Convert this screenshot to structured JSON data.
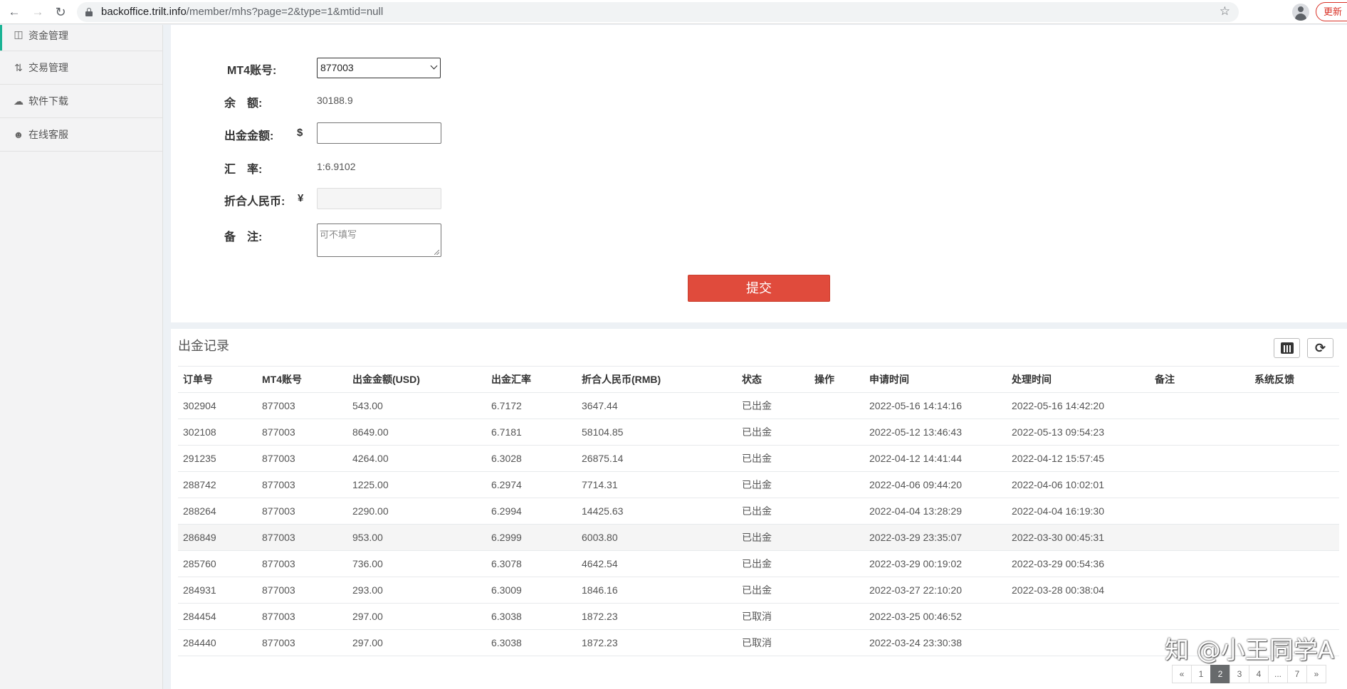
{
  "browser": {
    "url_host": "backoffice.trilt.info",
    "url_path": "/member/mhs?page=2&type=1&mtid=null",
    "update_label": "更新"
  },
  "sidebar": {
    "items": [
      {
        "label": "资金管理",
        "icon": "wallet-icon"
      },
      {
        "label": "交易管理",
        "icon": "trade-icon"
      },
      {
        "label": "软件下载",
        "icon": "cloud-download-icon"
      },
      {
        "label": "在线客服",
        "icon": "user-icon"
      }
    ]
  },
  "form": {
    "account_label": "MT4账号:",
    "account_value": "877003",
    "balance_label": "余　额:",
    "balance_value": "30188.9",
    "amount_label": "出金金额:",
    "amount_symbol": "$",
    "amount_value": "",
    "rate_label": "汇　率:",
    "rate_value": "1:6.9102",
    "rmb_label": "折合人民币:",
    "rmb_symbol": "¥",
    "rmb_value": "",
    "remark_label": "备　注:",
    "remark_placeholder": "可不填写",
    "submit_label": "提交"
  },
  "records": {
    "title": "出金记录",
    "columns": [
      "订单号",
      "MT4账号",
      "出金金额(USD)",
      "出金汇率",
      "折合人民币(RMB)",
      "状态",
      "操作",
      "申请时间",
      "处理时间",
      "备注",
      "系统反馈"
    ],
    "rows": [
      [
        "302904",
        "877003",
        "543.00",
        "6.7172",
        "3647.44",
        "已出金",
        "",
        "2022-05-16 14:14:16",
        "2022-05-16 14:42:20",
        "",
        ""
      ],
      [
        "302108",
        "877003",
        "8649.00",
        "6.7181",
        "58104.85",
        "已出金",
        "",
        "2022-05-12 13:46:43",
        "2022-05-13 09:54:23",
        "",
        ""
      ],
      [
        "291235",
        "877003",
        "4264.00",
        "6.3028",
        "26875.14",
        "已出金",
        "",
        "2022-04-12 14:41:44",
        "2022-04-12 15:57:45",
        "",
        ""
      ],
      [
        "288742",
        "877003",
        "1225.00",
        "6.2974",
        "7714.31",
        "已出金",
        "",
        "2022-04-06 09:44:20",
        "2022-04-06 10:02:01",
        "",
        ""
      ],
      [
        "288264",
        "877003",
        "2290.00",
        "6.2994",
        "14425.63",
        "已出金",
        "",
        "2022-04-04 13:28:29",
        "2022-04-04 16:19:30",
        "",
        ""
      ],
      [
        "286849",
        "877003",
        "953.00",
        "6.2999",
        "6003.80",
        "已出金",
        "",
        "2022-03-29 23:35:07",
        "2022-03-30 00:45:31",
        "",
        ""
      ],
      [
        "285760",
        "877003",
        "736.00",
        "6.3078",
        "4642.54",
        "已出金",
        "",
        "2022-03-29 00:19:02",
        "2022-03-29 00:54:36",
        "",
        ""
      ],
      [
        "284931",
        "877003",
        "293.00",
        "6.3009",
        "1846.16",
        "已出金",
        "",
        "2022-03-27 22:10:20",
        "2022-03-28 00:38:04",
        "",
        ""
      ],
      [
        "284454",
        "877003",
        "297.00",
        "6.3038",
        "1872.23",
        "已取消",
        "",
        "2022-03-25 00:46:52",
        "",
        "",
        ""
      ],
      [
        "284440",
        "877003",
        "297.00",
        "6.3038",
        "1872.23",
        "已取消",
        "",
        "2022-03-24 23:30:38",
        "",
        "",
        ""
      ]
    ],
    "highlighted_row": 5
  },
  "pagination": {
    "items": [
      "«",
      "1",
      "2",
      "3",
      "4",
      "...",
      "7",
      "»"
    ],
    "current": "2"
  },
  "watermark": "知 @小王同学A"
}
